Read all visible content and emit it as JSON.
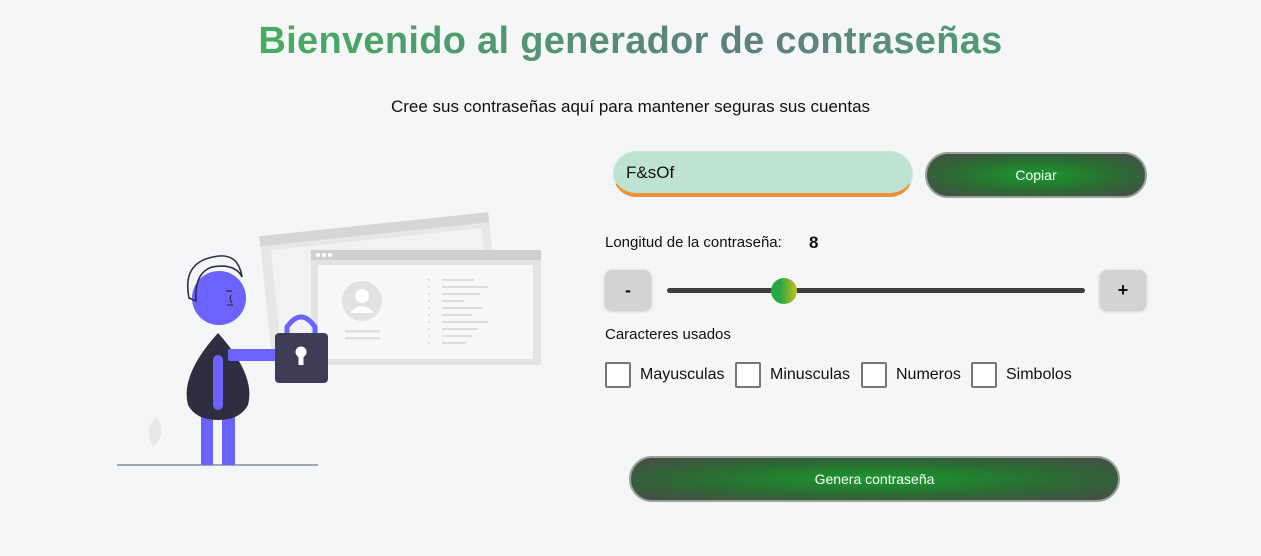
{
  "header": {
    "title": "Bienvenido al generador de contraseñas",
    "subtitle": "Cree sus contraseñas aquí para mantener seguras sus cuentas"
  },
  "password": {
    "value": "F&sOf"
  },
  "copy_button": {
    "label": "Copiar"
  },
  "length": {
    "label": "Longitud de la contraseña:",
    "value": "8",
    "slider_fraction": 0.28
  },
  "stepper": {
    "decrement": "-",
    "increment": "+"
  },
  "characters": {
    "label": "Caracteres usados",
    "options": [
      {
        "label": "Mayusculas",
        "checked": false
      },
      {
        "label": "Minusculas",
        "checked": false
      },
      {
        "label": "Numeros",
        "checked": false
      },
      {
        "label": "Simbolos",
        "checked": false
      }
    ]
  },
  "generate_button": {
    "label": "Genera contraseña"
  },
  "illustration": {
    "icon": "person-with-padlock-illustration"
  },
  "colors": {
    "accent_green": "#1a9a2a",
    "field_bg": "#bfe3d2",
    "field_underline": "#f0913a",
    "figure_purple": "#6c63ff",
    "lock_dark": "#3f3d56"
  }
}
